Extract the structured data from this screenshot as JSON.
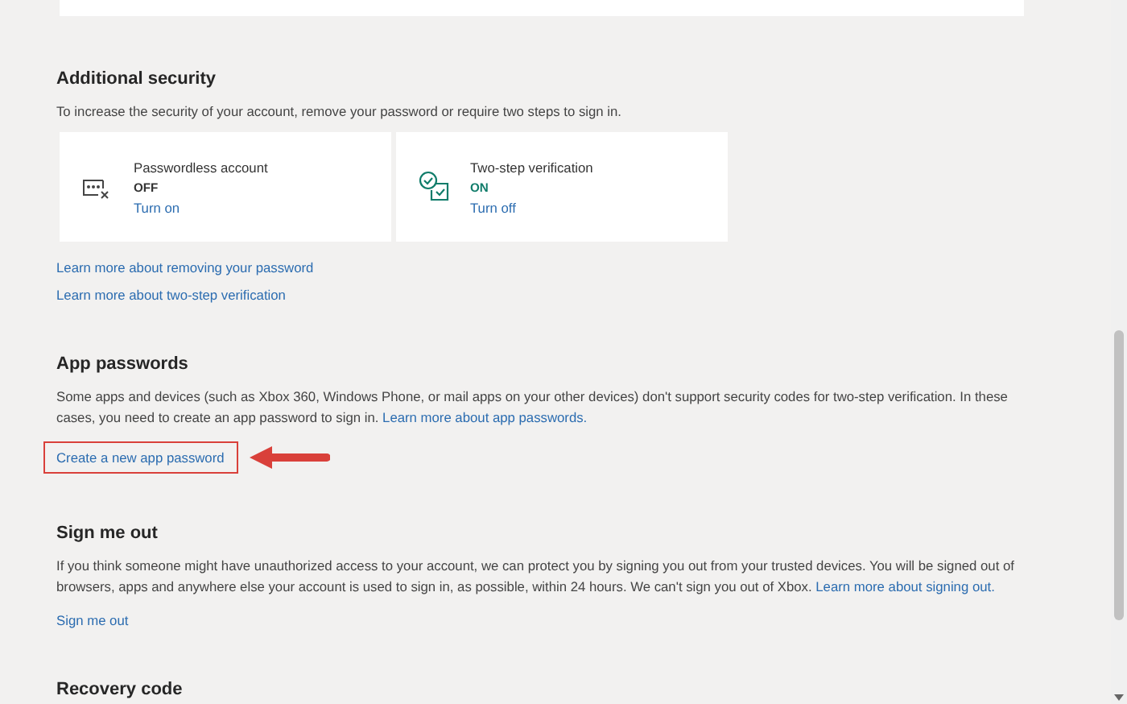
{
  "sections": [
    {
      "title": "Additional security",
      "description": "To increase the security of your account, remove your password or require two steps to sign in.",
      "cards": [
        {
          "kind": "passwordless",
          "title": "Passwordless account",
          "status": "OFF",
          "on": false,
          "action": "Turn on"
        },
        {
          "kind": "two-step",
          "title": "Two-step verification",
          "status": "ON",
          "on": true,
          "action": "Turn off"
        }
      ],
      "links": [
        {
          "label": "Learn more about removing your password",
          "highlighted": false
        },
        {
          "label": "Learn more about two-step verification",
          "highlighted": false
        }
      ]
    },
    {
      "title": "App passwords",
      "description": "Some apps and devices (such as Xbox 360, Windows Phone, or mail apps on your other devices) don't support security codes for two-step verification. In these cases, you need to create an app password to sign in.",
      "inline_link": "Learn more about app passwords.",
      "links": [
        {
          "label": "Create a new app password",
          "highlighted": true
        }
      ]
    },
    {
      "title": "Sign me out",
      "description": "If you think someone might have unauthorized access to your account, we can protect you by signing you out from your trusted devices. You will be signed out of browsers, apps and anywhere else your account is used to sign in, as possible, within 24 hours. We can't sign you out of Xbox.",
      "inline_link": "Learn more about signing out.",
      "links": [
        {
          "label": "Sign me out",
          "highlighted": false
        }
      ]
    },
    {
      "title": "Recovery code"
    }
  ]
}
